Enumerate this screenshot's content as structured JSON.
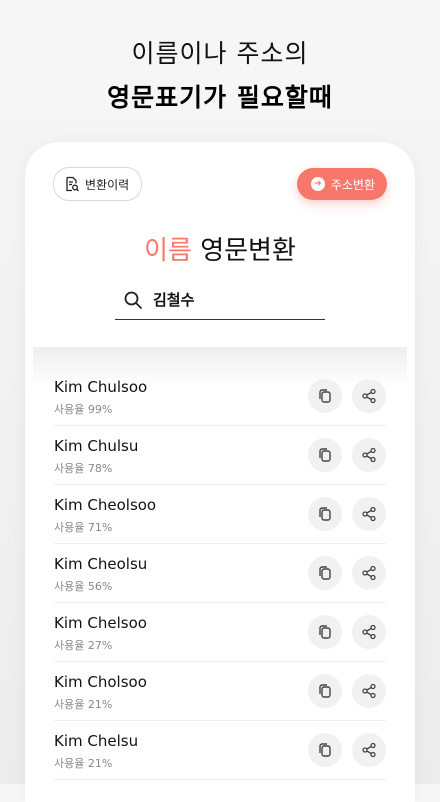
{
  "promo": {
    "line1": "이름이나 주소의",
    "line2": "영문표기가 필요할때"
  },
  "toolbar": {
    "history_label": "변환이력",
    "convert_label": "주소변환"
  },
  "heading": {
    "accent": "이름",
    "rest": " 영문변환"
  },
  "search": {
    "value": "김철수"
  },
  "results": [
    {
      "name": "Kim Chulsoo",
      "usage": "사용율 99%"
    },
    {
      "name": "Kim Chulsu",
      "usage": "사용율 78%"
    },
    {
      "name": "Kim Cheolsoo",
      "usage": "사용율 71%"
    },
    {
      "name": "Kim Cheolsu",
      "usage": "사용율 56%"
    },
    {
      "name": "Kim Chelsoo",
      "usage": "사용율 27%"
    },
    {
      "name": "Kim Cholsoo",
      "usage": "사용율 21%"
    },
    {
      "name": "Kim Chelsu",
      "usage": "사용율 21%"
    }
  ],
  "colors": {
    "accent": "#f7786a"
  }
}
